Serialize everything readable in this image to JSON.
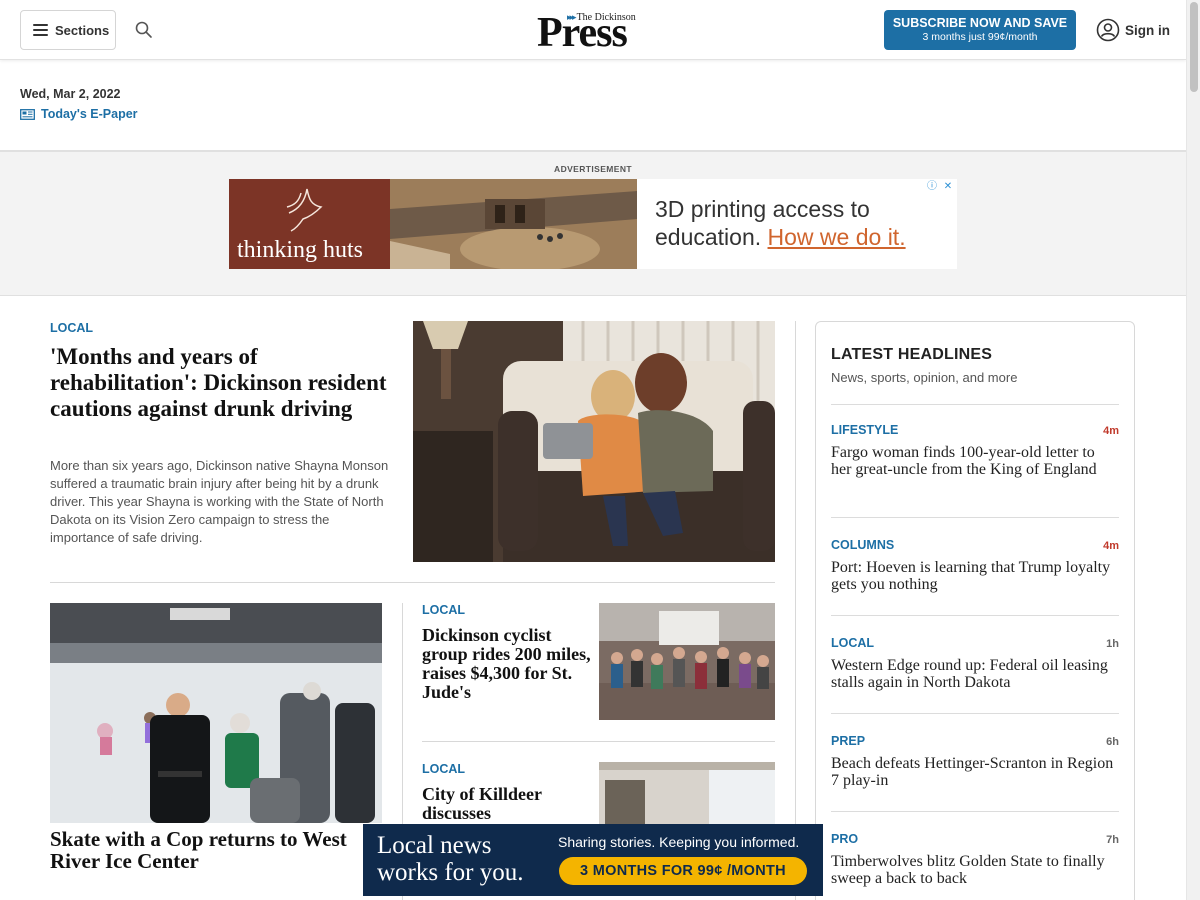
{
  "header": {
    "sections_label": "Sections",
    "logo_small": "The Dickinson",
    "logo_big": "Press",
    "subscribe_line1": "SUBSCRIBE NOW AND SAVE",
    "subscribe_line2": "3 months just 99¢/month",
    "signin_label": "Sign in"
  },
  "dateline": {
    "date": "Wed, Mar 2, 2022",
    "epaper_label": "Today's E-Paper"
  },
  "ad": {
    "label": "ADVERTISEMENT",
    "brand": "thinking huts",
    "headline": "3D printing access to education.",
    "cta": "How we do it.",
    "info_glyph": "ⓘ",
    "close_glyph": "✕"
  },
  "lead": {
    "kicker": "LOCAL",
    "title": "'Months and years of rehabilitation': Dickinson resident cautions against drunk driving",
    "summary": "More than six years ago, Dickinson native Shayna Monson suffered a traumatic brain injury after being hit by a drunk driver. This year Shayna is working with the State of North Dakota on its Vision Zero campaign to stress the importance of safe driving."
  },
  "skate": {
    "title": "Skate with a Cop returns to West River Ice Center"
  },
  "story2": {
    "kicker": "LOCAL",
    "title": "Dickinson cyclist group rides 200 miles, raises $4,300 for St. Jude's"
  },
  "story3": {
    "kicker": "LOCAL",
    "title": "City of Killdeer discusses"
  },
  "latest": {
    "title": "LATEST HEADLINES",
    "subtitle": "News, sports, opinion, and more",
    "items": [
      {
        "kicker": "LIFESTYLE",
        "time": "4m",
        "headline": "Fargo woman finds 100-year-old letter to her great-uncle from the King of England"
      },
      {
        "kicker": "COLUMNS",
        "time": "4m",
        "headline": "Port: Hoeven is learning that Trump loyalty gets you nothing"
      },
      {
        "kicker": "LOCAL",
        "time": "1h",
        "headline": "Western Edge round up: Federal oil leasing stalls again in North Dakota"
      },
      {
        "kicker": "PREP",
        "time": "6h",
        "headline": "Beach defeats Hettinger-Scranton in Region 7 play-in"
      },
      {
        "kicker": "PRO",
        "time": "7h",
        "headline": "Timberwolves blitz Golden State to finally sweep a back to back"
      }
    ]
  },
  "promo": {
    "line1": "Local news",
    "line2": "works for you.",
    "tagline": "Sharing stories. Keeping you informed.",
    "button": "3 MONTHS FOR 99¢ /MONTH"
  },
  "colors": {
    "accent": "#1d6fa5",
    "fresh_time": "#c0392b",
    "promo_bg": "#0f2a4c",
    "promo_button": "#f4b400"
  }
}
